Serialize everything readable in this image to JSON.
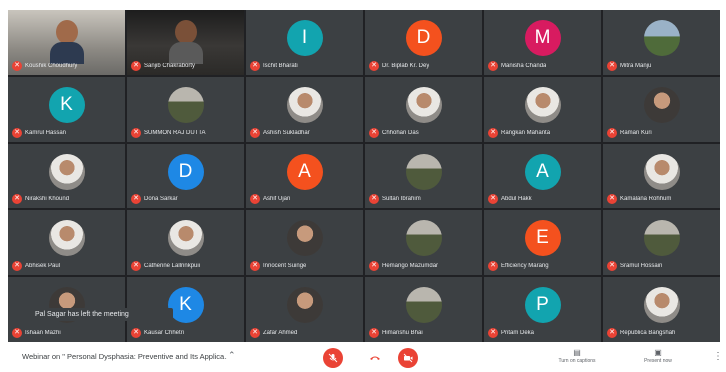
{
  "colors": {
    "stage": "#202124",
    "tile": "#3c4043",
    "muted_badge": "#ea4335",
    "name_text": "#e8eaed"
  },
  "participants": [
    {
      "name": "Koushik Choudhury",
      "kind": "video"
    },
    {
      "name": "Sanjib Chakraborty",
      "kind": "video-dark"
    },
    {
      "name": "Ischit Bharati",
      "kind": "letter",
      "letter": "I",
      "color": "#12a4af"
    },
    {
      "name": "Dr. Biplab Kr. Dey",
      "kind": "letter",
      "letter": "D",
      "color": "#f4511e"
    },
    {
      "name": "Manisha Chanda",
      "kind": "letter",
      "letter": "M",
      "color": "#d81b60"
    },
    {
      "name": "Mitra Manju",
      "kind": "photo-land"
    },
    {
      "name": "Kamrul Hassan",
      "kind": "letter",
      "letter": "K",
      "color": "#12a4af"
    },
    {
      "name": "SUMMON RAJ DUTTA",
      "kind": "photo-out"
    },
    {
      "name": "Ashish Sukladhar",
      "kind": "photo-light"
    },
    {
      "name": "Chhohan Das",
      "kind": "photo-light"
    },
    {
      "name": "Rangkan Mahanta",
      "kind": "photo-light"
    },
    {
      "name": "Raman Kuri",
      "kind": "photo"
    },
    {
      "name": "Nirakshi Khound",
      "kind": "photo-light"
    },
    {
      "name": "Dona Sarkar",
      "kind": "letter",
      "letter": "D",
      "color": "#1e88e5"
    },
    {
      "name": "Ashif Ujan",
      "kind": "letter",
      "letter": "A",
      "color": "#f4511e"
    },
    {
      "name": "Sultan Ibrahim",
      "kind": "photo-out"
    },
    {
      "name": "Abdul Hakk",
      "kind": "letter",
      "letter": "A",
      "color": "#12a4af"
    },
    {
      "name": "Kamalana Rohhum",
      "kind": "photo-light"
    },
    {
      "name": "Abhisek Paul",
      "kind": "photo-light"
    },
    {
      "name": "Catherine Lallrinkpuii",
      "kind": "photo-light"
    },
    {
      "name": "Innocent Suinge",
      "kind": "photo"
    },
    {
      "name": "Hemango Mazumdar",
      "kind": "photo-out"
    },
    {
      "name": "Efficiency Marang",
      "kind": "letter",
      "letter": "E",
      "color": "#f4511e"
    },
    {
      "name": "Sramul Hossain",
      "kind": "photo-out"
    },
    {
      "name": "Ishaan Mazhi",
      "kind": "photo"
    },
    {
      "name": "Kausar Chhetri",
      "kind": "letter",
      "letter": "K",
      "color": "#1e88e5"
    },
    {
      "name": "Zafar Ahmed",
      "kind": "photo"
    },
    {
      "name": "Himanshu Bhai",
      "kind": "photo-out"
    },
    {
      "name": "Pritam Deka",
      "kind": "letter",
      "letter": "P",
      "color": "#12a4af"
    },
    {
      "name": "Republica Bangshah",
      "kind": "photo-light"
    }
  ],
  "toast": "Pal Sagar has left the meeting",
  "bottom_bar": {
    "meeting_title": "Webinar on \" Personal Dysphasia: Preventive and Its Applica...",
    "captions_label": "Turn on captions",
    "present_label": "Present now"
  }
}
